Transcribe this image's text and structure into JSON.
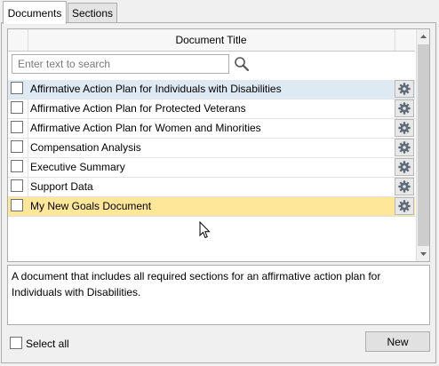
{
  "tabs": [
    {
      "label": "Documents",
      "active": true
    },
    {
      "label": "Sections",
      "active": false
    }
  ],
  "grid": {
    "column_header": "Document Title",
    "search_placeholder": "Enter text to search",
    "search_value": "",
    "rows": [
      {
        "title": "Affirmative Action Plan for Individuals with Disabilities",
        "checked": false,
        "state": "selected"
      },
      {
        "title": "Affirmative Action Plan for Protected Veterans",
        "checked": false,
        "state": "normal"
      },
      {
        "title": "Affirmative Action Plan for Women and Minorities",
        "checked": false,
        "state": "normal"
      },
      {
        "title": "Compensation Analysis",
        "checked": false,
        "state": "normal"
      },
      {
        "title": "Executive Summary",
        "checked": false,
        "state": "normal"
      },
      {
        "title": "Support Data",
        "checked": false,
        "state": "normal"
      },
      {
        "title": "My New Goals Document",
        "checked": false,
        "state": "highlighted"
      }
    ]
  },
  "description": "A document that includes all required sections for an affirmative action plan for Individuals with Disabilities.",
  "footer": {
    "select_all_label": "Select all",
    "new_button_label": "New"
  },
  "icons": {
    "row_action": "gear-icon",
    "search": "search-icon"
  },
  "colors": {
    "selected_row": "#dde9f3",
    "highlighted_row": "#ffe79a"
  }
}
